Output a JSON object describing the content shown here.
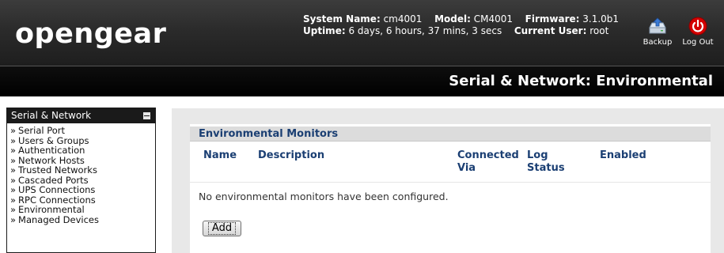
{
  "brand": {
    "logo_text": "opengear"
  },
  "system_info": {
    "system_name_label": "System Name:",
    "system_name": "cm4001",
    "model_label": "Model:",
    "model": "CM4001",
    "firmware_label": "Firmware:",
    "firmware": "3.1.0b1",
    "uptime_label": "Uptime:",
    "uptime": "6 days, 6 hours, 37 mins, 3 secs",
    "current_user_label": "Current User:",
    "current_user": "root"
  },
  "header_actions": {
    "backup_label": "Backup",
    "logout_label": "Log Out"
  },
  "page_title": "Serial & Network: Environmental",
  "sidebar": {
    "heading": "Serial & Network",
    "items": [
      {
        "label": "Serial Port"
      },
      {
        "label": "Users & Groups"
      },
      {
        "label": "Authentication"
      },
      {
        "label": "Network Hosts"
      },
      {
        "label": "Trusted Networks"
      },
      {
        "label": "Cascaded Ports"
      },
      {
        "label": "UPS Connections"
      },
      {
        "label": "RPC Connections"
      },
      {
        "label": "Environmental"
      },
      {
        "label": "Managed Devices"
      }
    ]
  },
  "monitors": {
    "section_title": "Environmental Monitors",
    "columns": {
      "name": "Name",
      "description": "Description",
      "connected_via_1": "Connected",
      "connected_via_2": "Via",
      "log_status_1": "Log",
      "log_status_2": "Status",
      "enabled": "Enabled"
    },
    "empty_message": "No environmental monitors have been configured.",
    "add_label": "Add"
  },
  "colors": {
    "header_bg": "#2b2b2b",
    "title_bar_bg": "#000000",
    "section_header_text": "#1b3f73",
    "logout_red": "#d40000"
  },
  "icons": {
    "backup": "backup-icon",
    "logout": "power-icon",
    "collapse": "collapse-icon",
    "bullet": "»"
  }
}
